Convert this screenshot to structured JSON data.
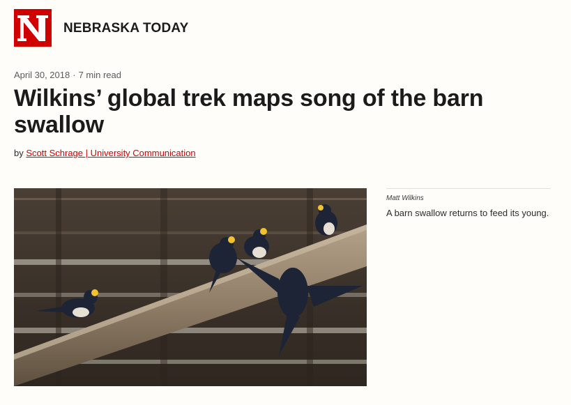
{
  "site": {
    "logo_letter": "N",
    "title": "NEBRASKA TODAY",
    "brand_color": "#d00000"
  },
  "article": {
    "date": "April 30, 2018",
    "separator": "·",
    "read_time": "7 min read",
    "headline": "Wilkins’ global trek maps song of the barn swallow",
    "byline_prefix": "by",
    "author": "Scott Schrage | University Communication"
  },
  "photo": {
    "icon": "barn-swallows-photo",
    "credit": "Matt Wilkins",
    "caption": "A barn swallow returns to feed its young."
  }
}
